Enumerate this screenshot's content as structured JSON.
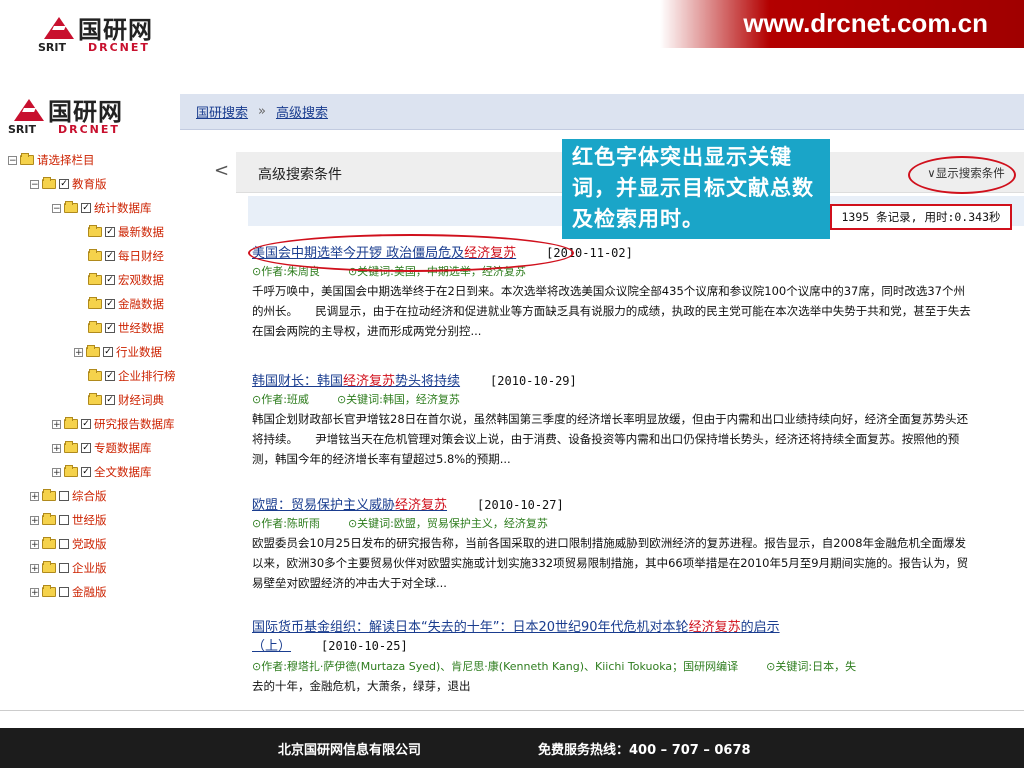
{
  "slide": {
    "logo_cn": "国研网",
    "logo_srit": "SRIT",
    "logo_drcnet": "DRCNET",
    "url": "www.drcnet.com.cn"
  },
  "app": {
    "logo_cn": "国研网",
    "logo_srit": "SRIT",
    "logo_drcnet": "DRCNET",
    "breadcrumb": {
      "home": "国研搜索",
      "separator": "»",
      "current": "高级搜索"
    }
  },
  "tree": [
    {
      "label": "请选择栏目",
      "toggle": "−",
      "checkbox": null
    },
    {
      "label": "教育版",
      "toggle": "−",
      "checkbox": "✓"
    },
    {
      "label": "统计数据库",
      "toggle": "−",
      "checkbox": "✓"
    },
    {
      "label": "最新数据",
      "toggle": null,
      "checkbox": "✓"
    },
    {
      "label": "每日财经",
      "toggle": null,
      "checkbox": "✓"
    },
    {
      "label": "宏观数据",
      "toggle": null,
      "checkbox": "✓"
    },
    {
      "label": "金融数据",
      "toggle": null,
      "checkbox": "✓"
    },
    {
      "label": "世经数据",
      "toggle": null,
      "checkbox": "✓"
    },
    {
      "label": "行业数据",
      "toggle": "+",
      "checkbox": "✓"
    },
    {
      "label": "企业排行榜",
      "toggle": null,
      "checkbox": "✓"
    },
    {
      "label": "财经词典",
      "toggle": null,
      "checkbox": "✓"
    },
    {
      "label": "研究报告数据库",
      "toggle": "+",
      "checkbox": "✓"
    },
    {
      "label": "专题数据库",
      "toggle": "+",
      "checkbox": "✓"
    },
    {
      "label": "全文数据库",
      "toggle": "+",
      "checkbox": "✓"
    },
    {
      "label": "综合版",
      "toggle": "+",
      "checkbox": ""
    },
    {
      "label": "世经版",
      "toggle": "+",
      "checkbox": ""
    },
    {
      "label": "党政版",
      "toggle": "+",
      "checkbox": ""
    },
    {
      "label": "企业版",
      "toggle": "+",
      "checkbox": ""
    },
    {
      "label": "金融版",
      "toggle": "+",
      "checkbox": ""
    }
  ],
  "collapse_glyph": "<",
  "search": {
    "condition_title": "高级搜索条件",
    "show_conditions": "∨显示搜索条件",
    "result_count": "1395 条记录, 用时:0.343秒"
  },
  "callout": "红色字体突出显示关键词，并显示目标文献总数及检索用时。",
  "results": [
    {
      "title_pre": "美国会中期选举今开锣 政治僵局危及",
      "title_hl": "经济复苏",
      "title_post": "",
      "date": "[2010-11-02]",
      "author": "⊙作者:朱周良",
      "keywords": "⊙关键词:美国，中期选举，经济复苏",
      "abstract": "千呼万唤中，美国国会中期选举终于在2日到来。本次选举将改选美国众议院全部435个议席和参议院100个议席中的37席，同时改选37个州的州长。　　民调显示，由于在拉动经济和促进就业等方面缺乏具有说服力的成绩，执政的民主党可能在本次选举中失势于共和党，甚至于失去在国会两院的主导权，进而形成两党分别控..."
    },
    {
      "title_pre": "韩国财长：韩国",
      "title_hl": "经济复苏",
      "title_post": "势头将持续",
      "date": "[2010-10-29]",
      "author": "⊙作者:班威",
      "keywords": "⊙关键词:韩国，经济复苏",
      "abstract": "韩国企划财政部长官尹增铉28日在首尔说，虽然韩国第三季度的经济增长率明显放缓，但由于内需和出口业绩持续向好，经济全面复苏势头还将持续。　　尹增铉当天在危机管理对策会议上说，由于消费、设备投资等内需和出口仍保持增长势头，经济还将持续全面复苏。按照他的预测，韩国今年的经济增长率有望超过5.8%的预期..."
    },
    {
      "title_pre": "欧盟：贸易保护主义威胁",
      "title_hl": "经济复苏",
      "title_post": "",
      "date": "[2010-10-27]",
      "author": "⊙作者:陈昕雨",
      "keywords": "⊙关键词:欧盟，贸易保护主义，经济复苏",
      "abstract": "欧盟委员会10月25日发布的研究报告称，当前各国采取的进口限制措施威胁到欧洲经济的复苏进程。报告显示，自2008年金融危机全面爆发以来，欧洲30多个主要贸易伙伴对欧盟实施或计划实施332项贸易限制措施，其中66项举措是在2010年5月至9月期间实施的。报告认为，贸易壁垒对欧盟经济的冲击大于对全球..."
    },
    {
      "title_pre": "国际货币基金组织：解读日本“失去的十年”：日本20世纪90年代危机对本轮",
      "title_hl": "经济复苏",
      "title_post": "的启示",
      "title_line2": "（上）",
      "date": "[2010-10-25]",
      "author": "⊙作者:穆塔扎·萨伊德(Murtaza Syed)、肯尼思·康(Kenneth Kang)、Kiichi Tokuoka；国研网编译",
      "keywords": "⊙关键词:日本，失",
      "abstract": "去的十年，金融危机，大萧条，绿芽，退出"
    }
  ],
  "footer": {
    "company": "北京国研网信息有限公司",
    "hotline": "免费服务热线：400 – 707 – 0678"
  }
}
